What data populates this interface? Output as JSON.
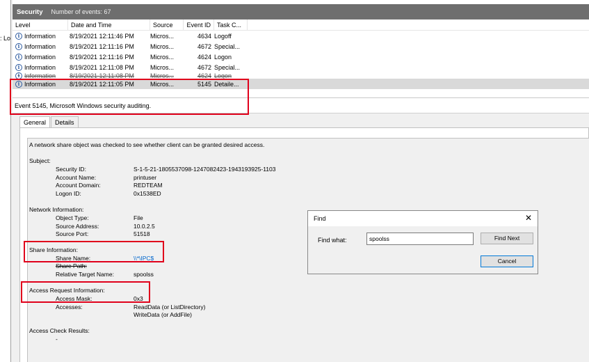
{
  "left_panel": {
    "stub_text": ": Lo"
  },
  "header": {
    "title": "Security",
    "count_text": "Number of events: 67"
  },
  "table": {
    "columns": [
      "Level",
      "Date and Time",
      "Source",
      "Event ID",
      "Task C..."
    ],
    "rows": [
      {
        "level": "Information",
        "date": "8/19/2021 12:11:46 PM",
        "source": "Micros...",
        "id": "4634",
        "task": "Logoff"
      },
      {
        "level": "Information",
        "date": "8/19/2021 12:11:16 PM",
        "source": "Micros...",
        "id": "4672",
        "task": "Special..."
      },
      {
        "level": "Information",
        "date": "8/19/2021 12:11:16 PM",
        "source": "Micros...",
        "id": "4624",
        "task": "Logon"
      },
      {
        "level": "Information",
        "date": "8/19/2021 12:11:08 PM",
        "source": "Micros...",
        "id": "4672",
        "task": "Special..."
      },
      {
        "level": "Information",
        "date": "8/19/2021 12:11:08 PM",
        "source": "Micros...",
        "id": "4624",
        "task": "Logon"
      },
      {
        "level": "Information",
        "date": "8/19/2021 12:11:05 PM",
        "source": "Micros...",
        "id": "5145",
        "task": "Detaile..."
      }
    ]
  },
  "details": {
    "event_title": "Event 5145, Microsoft Windows security auditing.",
    "tabs": [
      "General",
      "Details"
    ],
    "description": "A network share object was checked to see whether client can be granted desired access.",
    "subject_header": "Subject:",
    "subject": {
      "security_id_label": "Security ID:",
      "security_id": "S-1-5-21-1805537098-1247082423-1943193925-1103",
      "account_name_label": "Account Name:",
      "account_name": "printuser",
      "account_domain_label": "Account Domain:",
      "account_domain": "REDTEAM",
      "logon_id_label": "Logon ID:",
      "logon_id": "0x1538ED"
    },
    "network_header": "Network Information:",
    "network": {
      "object_type_label": "Object Type:",
      "object_type": "File",
      "source_address_label": "Source Address:",
      "source_address": "10.0.2.5",
      "source_port_label": "Source Port:",
      "source_port": "51518"
    },
    "share_header": "Share Information:",
    "share": {
      "share_name_label": "Share Name:",
      "share_name": "\\\\*\\IPC$",
      "share_path_label": "Share Path:",
      "relative_target_label": "Relative Target Name:",
      "relative_target": "spoolss"
    },
    "access_header": "Access Request Information:",
    "access": {
      "mask_label": "Access Mask:",
      "mask": "0x3",
      "accesses_label": "Accesses:",
      "accesses_1": "ReadData (or ListDirectory)",
      "accesses_2": "WriteData (or AddFile)"
    },
    "check_header": "Access Check Results:",
    "check_value": "-"
  },
  "find_dialog": {
    "title": "Find",
    "close_glyph": "✕",
    "label": "Find what:",
    "value": "spoolss",
    "find_next_label": "Find Next",
    "cancel_label": "Cancel"
  },
  "colors": {
    "highlight": "#e0001b",
    "header_bg": "#6e6e6e",
    "link": "#0066cc"
  }
}
